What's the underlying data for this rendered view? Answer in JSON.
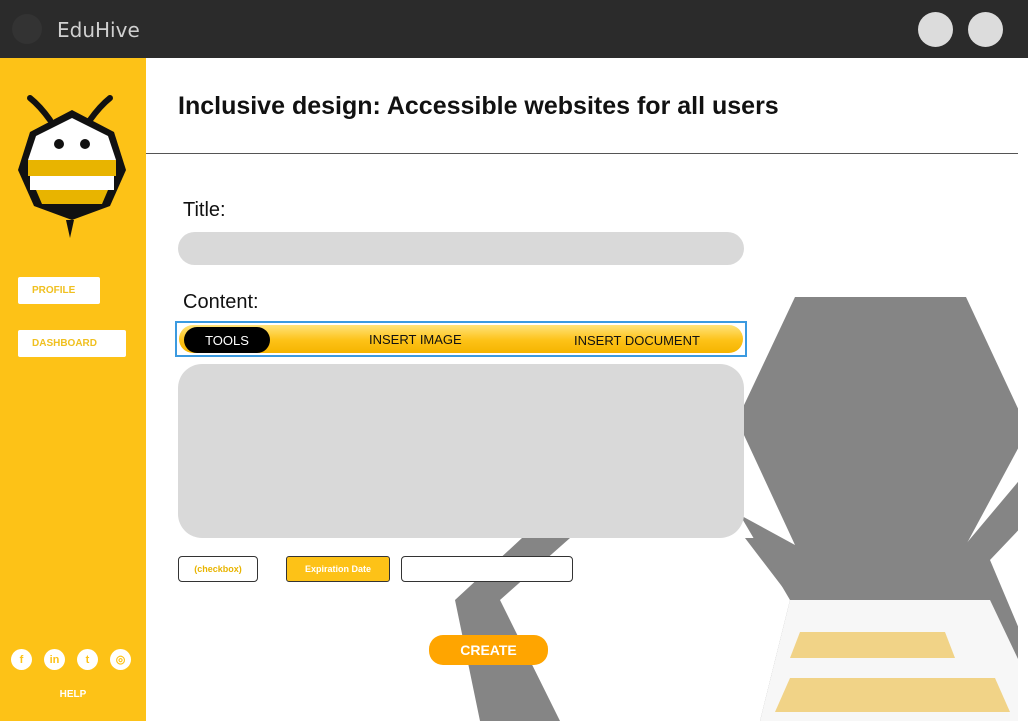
{
  "app": {
    "title": "EduHive"
  },
  "colors": {
    "accent": "#fdc217",
    "create": "#ffa500",
    "toolbar_border": "#3b9ae0",
    "topbar": "#2b2b2b"
  },
  "sidebar": {
    "items": [
      {
        "label": "PROFILE"
      },
      {
        "label": "DASHBOARD"
      }
    ],
    "social_icons": [
      "facebook-icon",
      "linkedin-icon",
      "twitter-icon",
      "instagram-icon"
    ],
    "help_label": "HELP"
  },
  "main": {
    "heading": "Inclusive design: Accessible websites for all users",
    "title_label": "Title:",
    "content_label": "Content:",
    "toolbar": {
      "tools": "TOOLS",
      "insert_image": "INSERT IMAGE",
      "insert_document": "INSERT DOCUMENT"
    },
    "checkbox_label": "(checkbox)",
    "expiration_label": "Expiration Date",
    "create_label": "CREATE"
  }
}
